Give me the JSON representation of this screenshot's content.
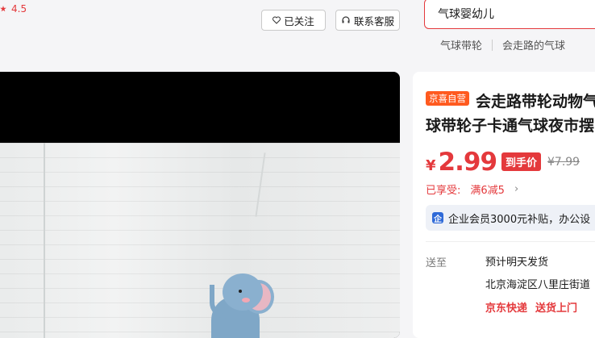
{
  "header": {
    "rating": "4.5",
    "follow_label": "已关注",
    "service_label": "联系客服",
    "search_value": "气球婴幼儿",
    "hotwords": [
      "气球带轮",
      "会走路的气球"
    ]
  },
  "product": {
    "store_tag": "京喜自营",
    "title_line1": "会走路带轮动物气",
    "title_line2": "球带轮子卡通气球夜市摆",
    "price_symbol": "¥",
    "price": "2.99",
    "final_price_badge": "到手价",
    "original_price": "¥7.99",
    "coupon_label": "已享受:",
    "coupon_value": "满6减5",
    "vip_icon": "企",
    "vip_text": "企业会员3000元补贴，办公设",
    "ship_label": "送至",
    "ship_time": "预计明天发货",
    "ship_address": "北京海淀区八里庄街道",
    "ship_carrier": "京东快递",
    "ship_service": "送货上门"
  },
  "colors": {
    "accent": "#e4393c",
    "tag": "#ff5a1f",
    "vip_icon": "#2f6ad8"
  }
}
